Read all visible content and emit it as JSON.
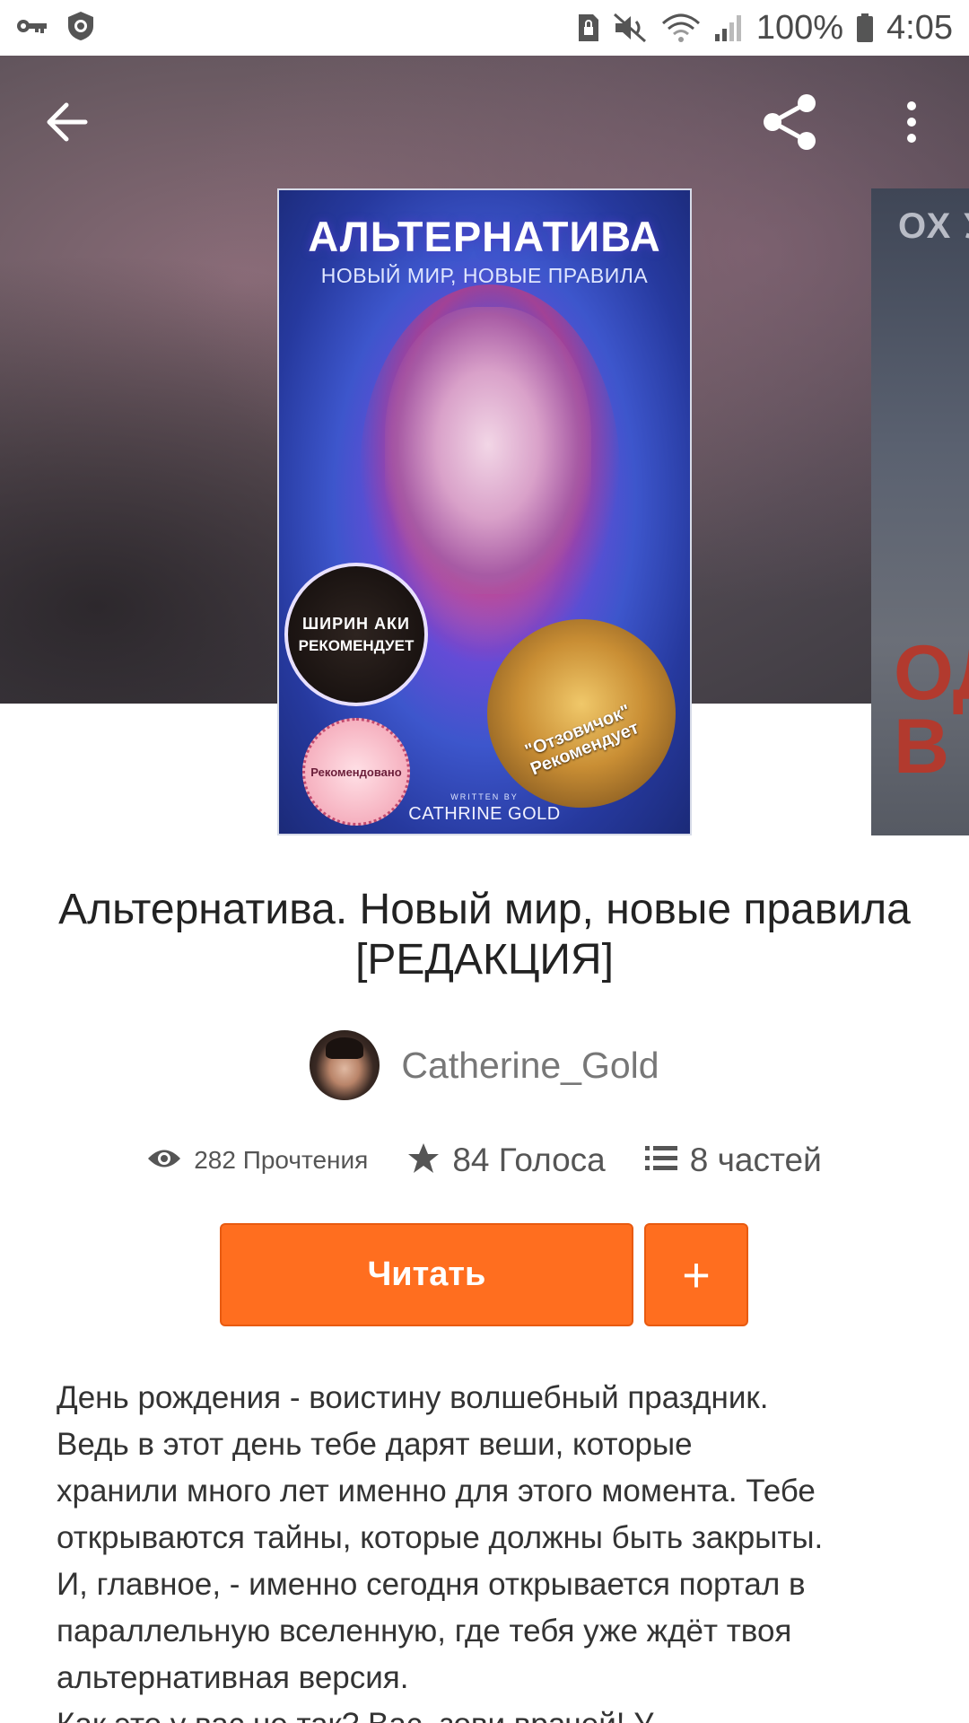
{
  "status_bar": {
    "battery_percent": "100%",
    "time": "4:05",
    "icons": [
      "vpn-key-icon",
      "shield-icon",
      "sim-lock-icon",
      "mute-icon",
      "wifi-icon",
      "signal-icon",
      "battery-icon"
    ]
  },
  "toolbar": {
    "icons": [
      "back-arrow-icon",
      "share-icon",
      "more-vert-icon"
    ]
  },
  "cover": {
    "title": "АЛЬТЕРНАТИВА",
    "subtitle": "НОВЫЙ МИР, НОВЫЕ ПРАВИЛА",
    "badge_dark_top": "ШИРИН АКИ",
    "badge_dark_main": "РЕКОМЕНДУЕТ",
    "badge_gold": "\"Отзовичок\" Рекомендует",
    "badge_pink": "Рекомендовано",
    "written_by": "WRITTEN BY",
    "author": "CATHRINE GOLD"
  },
  "next_cover": {
    "top_text": "ОХ У",
    "red_text": "ОД В"
  },
  "book": {
    "title": "Альтернатива. Новый мир, новые правила  [РЕДАКЦИЯ]",
    "author": "Catherine_Gold"
  },
  "stats": {
    "reads": "282 Прочтения",
    "votes": "84 Голоса",
    "parts": "8 частей"
  },
  "actions": {
    "read_label": "Читать",
    "add_label": "+"
  },
  "description": {
    "lines": [
      "День рождения - воистину волшебный праздник.",
      "Ведь в этот день тебе дарят веши, которые",
      "хранили много лет именно для этого момента. Тебе",
      "открываются тайны, которые должны быть закрыты.",
      "И, главное, - именно сегодня открывается портал в",
      "параллельную вселенную, где тебя уже ждёт твоя",
      "альтернативная версия.",
      "Как это у вас не так? Вас, зови врачей! У"
    ]
  },
  "colors": {
    "accent": "#ff6e1f",
    "title_text": "#222222",
    "author_text": "#777777"
  }
}
